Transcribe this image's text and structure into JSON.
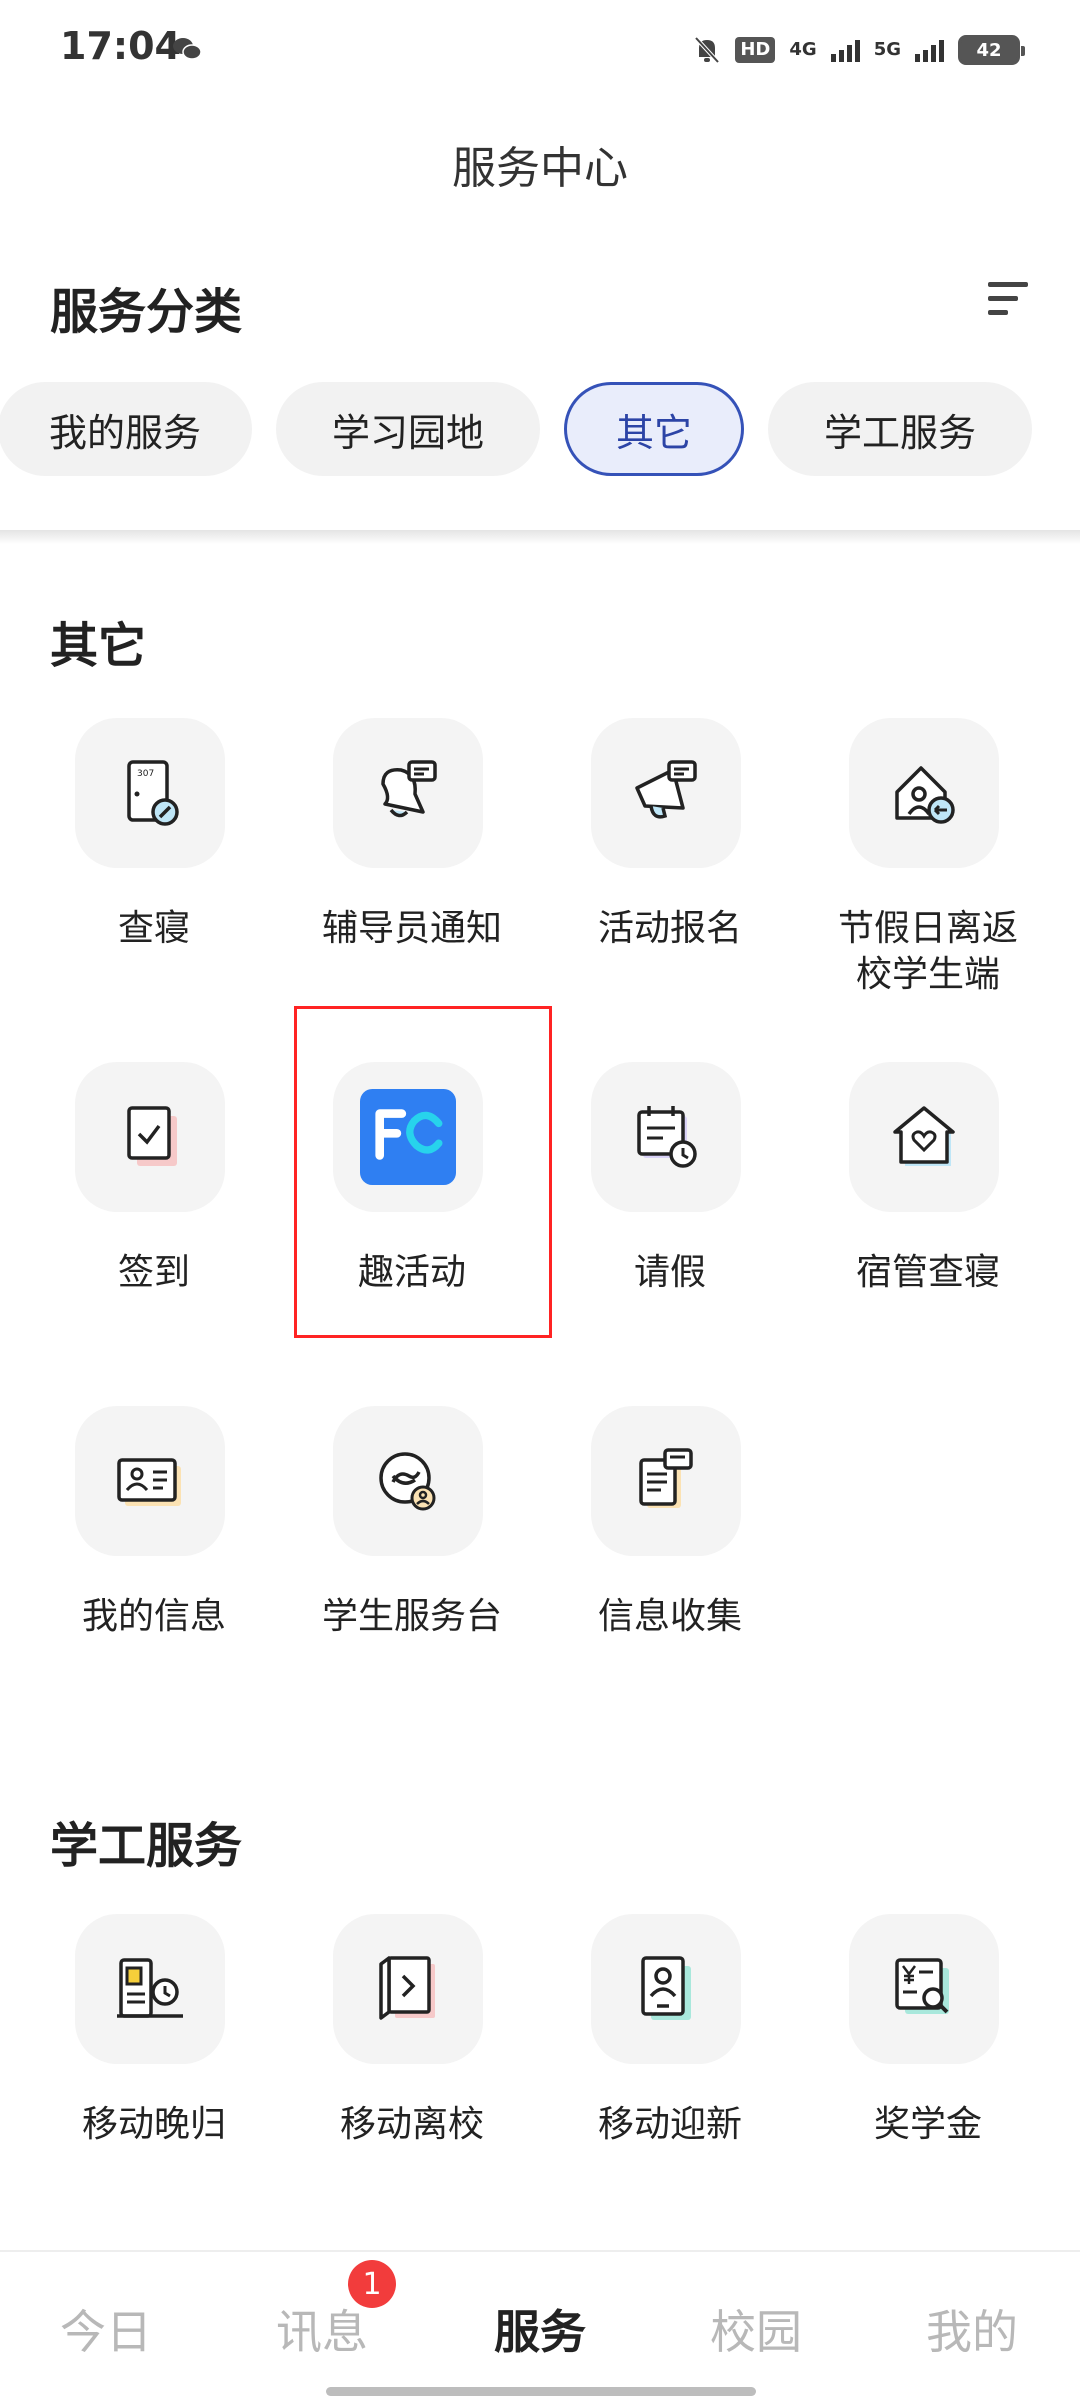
{
  "status_bar": {
    "time": "17:04",
    "hd_label": "HD",
    "net_4g": "4G",
    "net_5g": "5G",
    "battery": "42",
    "icons": [
      "wechat-icon",
      "mute-bell-icon",
      "signal-icon",
      "battery-icon"
    ]
  },
  "header": {
    "title": "服务中心"
  },
  "categories": {
    "title": "服务分类",
    "chips": [
      "我的服务",
      "学习园地",
      "其它",
      "学工服务"
    ],
    "active_chip": "其它"
  },
  "sections": [
    {
      "title": "其它",
      "items": [
        {
          "label": "查寝",
          "icon": "door-check-icon"
        },
        {
          "label": "辅导员通知",
          "icon": "bell-message-icon"
        },
        {
          "label": "活动报名",
          "icon": "megaphone-icon"
        },
        {
          "label": "节假日离返校学生端",
          "label_line1": "节假日离返",
          "label_line2": "校学生端",
          "icon": "home-return-icon"
        },
        {
          "label": "签到",
          "icon": "checkin-doc-icon"
        },
        {
          "label": "趣活动",
          "icon": "fun-activity-app-icon"
        },
        {
          "label": "请假",
          "icon": "calendar-clock-icon"
        },
        {
          "label": "宿管查寝",
          "icon": "house-heart-icon"
        },
        {
          "label": "我的信息",
          "icon": "id-card-icon"
        },
        {
          "label": "学生服务台",
          "icon": "service-desk-icon"
        },
        {
          "label": "信息收集",
          "icon": "form-collect-icon"
        }
      ]
    },
    {
      "title": "学工服务",
      "items": [
        {
          "label": "移动晚归",
          "icon": "late-return-icon"
        },
        {
          "label": "移动离校",
          "icon": "leave-door-icon"
        },
        {
          "label": "移动迎新",
          "icon": "welcome-profile-icon"
        },
        {
          "label": "奖学金",
          "icon": "scholarship-icon"
        }
      ]
    }
  ],
  "bottom_nav": {
    "items": [
      "今日",
      "讯息",
      "服务",
      "校园",
      "我的"
    ],
    "active": "服务",
    "badge": "1"
  },
  "colors": {
    "accent": "#3552b8",
    "highlight": "#ff2323",
    "badge": "#f23c3c"
  }
}
